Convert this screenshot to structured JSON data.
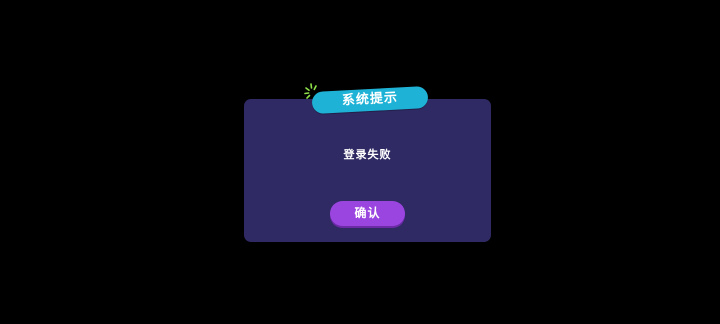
{
  "dialog": {
    "title": "系统提示",
    "message": "登录失败",
    "confirm_label": "确认"
  },
  "colors": {
    "background": "#000000",
    "dialog_bg": "#2f2a63",
    "title_tag": "#1eb2d6",
    "confirm_button": "#9b45e0",
    "sparkle": "#8fe04a"
  },
  "icons": {
    "sparkle": "sparkle-icon"
  }
}
